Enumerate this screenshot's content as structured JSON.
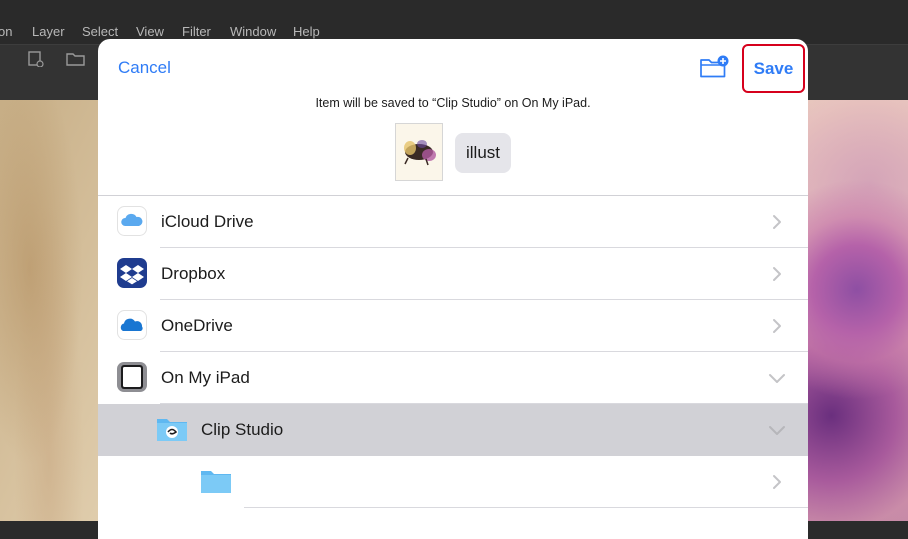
{
  "app": {
    "menu": [
      "on",
      "Layer",
      "Select",
      "View",
      "Filter",
      "Window",
      "Help"
    ]
  },
  "sheet": {
    "cancel_label": "Cancel",
    "save_label": "Save",
    "save_info": "Item will be saved to “Clip Studio” on On My iPad.",
    "file_name": "illust"
  },
  "locations": [
    {
      "label": "iCloud Drive",
      "icon": "icloud-icon",
      "chevron": "right"
    },
    {
      "label": "Dropbox",
      "icon": "dropbox-icon",
      "chevron": "right"
    },
    {
      "label": "OneDrive",
      "icon": "onedrive-icon",
      "chevron": "right"
    },
    {
      "label": "On My iPad",
      "icon": "ipad-icon",
      "chevron": "down"
    },
    {
      "label": "Clip Studio",
      "icon": "clip-studio-folder-icon",
      "chevron": "down",
      "selected": true
    },
    {
      "label": "",
      "icon": "folder-icon",
      "chevron": "right"
    }
  ],
  "colors": {
    "accent": "#2f7cf6",
    "highlight_border": "#d6001c",
    "selected_row": "#d1d1d6"
  }
}
